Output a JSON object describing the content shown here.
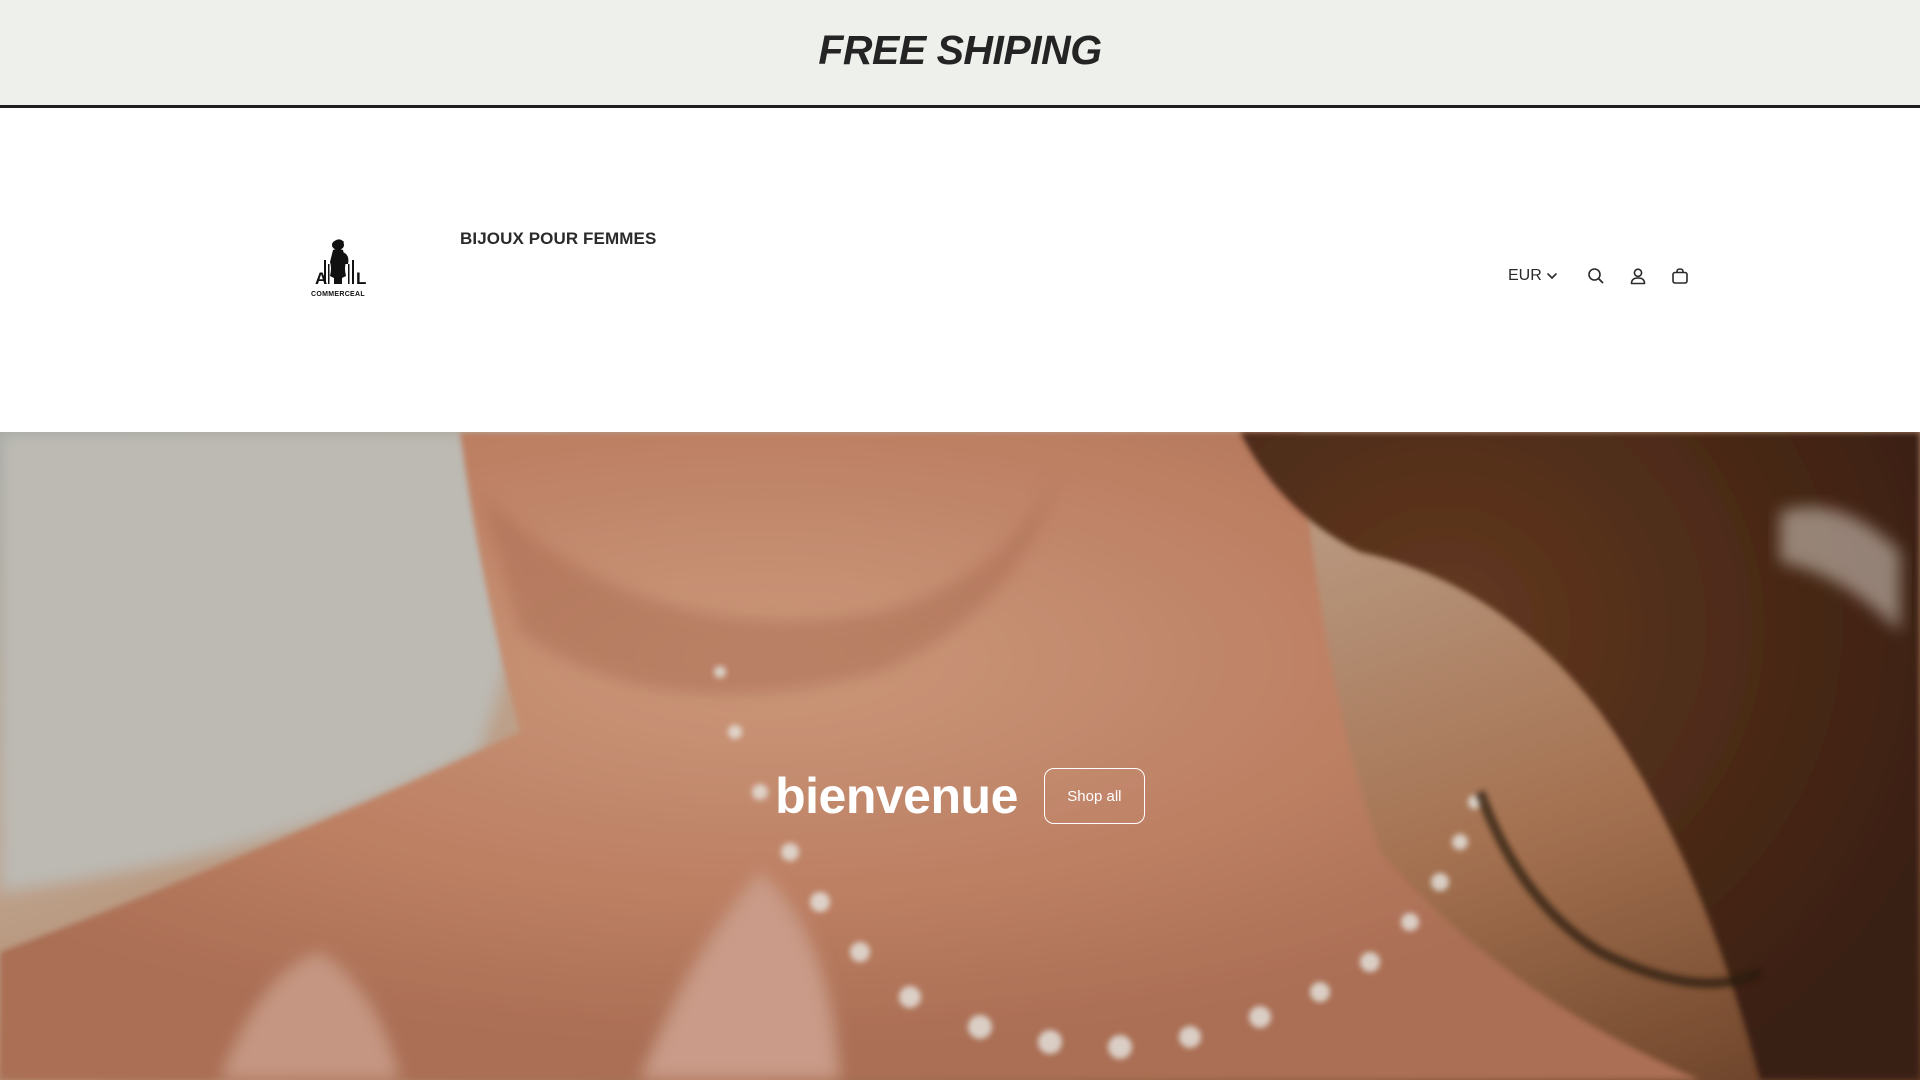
{
  "announcement": {
    "text": "FREE SHIPING"
  },
  "header": {
    "logo": {
      "brand_lines": [
        "A",
        "L",
        "COMMERCEAL"
      ]
    },
    "nav": {
      "items": [
        {
          "label": "BIJOUX POUR FEMMES"
        }
      ]
    },
    "currency": {
      "selected": "EUR"
    },
    "icons": [
      "search-icon",
      "account-icon",
      "cart-icon",
      "chevron-down-icon"
    ]
  },
  "hero": {
    "title": "bienvenue",
    "button_label": "Shop all"
  },
  "colors": {
    "announcement_bg": "#eef0eb",
    "text_dark": "#242424",
    "hero_overlay_text": "#ffffff"
  }
}
